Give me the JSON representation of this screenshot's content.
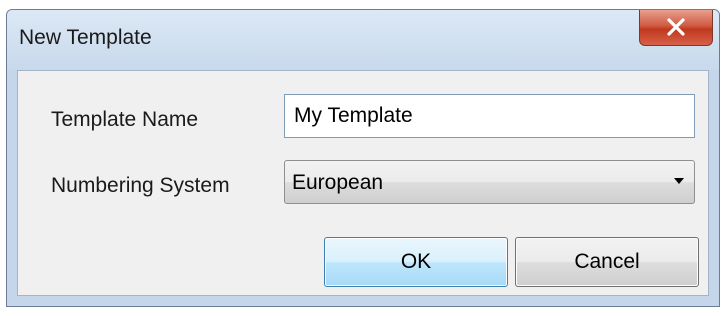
{
  "window": {
    "title": "New Template",
    "close_icon": "close-icon"
  },
  "form": {
    "template_name_label": "Template Name",
    "template_name_value": "My Template",
    "numbering_system_label": "Numbering System",
    "numbering_system_value": "European"
  },
  "buttons": {
    "ok_label": "OK",
    "cancel_label": "Cancel"
  },
  "colors": {
    "title_bar": "#c8d9ec",
    "close_button": "#c0391e",
    "ok_button_accent": "#3c7fb1"
  }
}
